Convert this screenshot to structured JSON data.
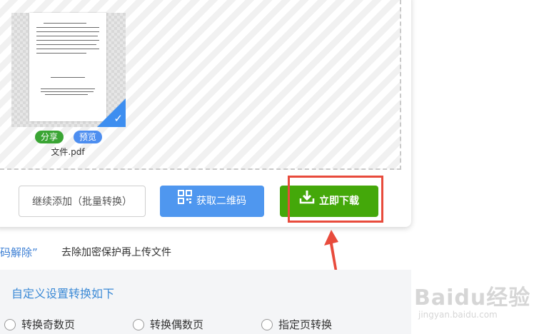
{
  "file_card": {
    "share_label": "分享",
    "preview_label": "预览",
    "filename": "文件.pdf",
    "selected": true
  },
  "actions": {
    "continue_label": "继续添加（批量转换）",
    "qr_label": "获取二维码",
    "download_label": "立即下载"
  },
  "notice": {
    "link_text": "码解除”",
    "description": "去除加密保护再上传文件"
  },
  "settings": {
    "title": "自定义设置转换如下",
    "options": [
      "转换奇数页",
      "转换偶数页",
      "指定页转换"
    ]
  },
  "watermark": {
    "main": "Baidu经验",
    "sub": "jingyan.baidu.com"
  },
  "colors": {
    "accent_green": "#44a80a",
    "accent_blue": "#4f97ef",
    "highlight_red": "#e84b3c",
    "link_blue": "#3c7fd4"
  },
  "icons": {
    "qr": "qr-code-icon",
    "download": "download-icon",
    "check": "check-icon"
  }
}
